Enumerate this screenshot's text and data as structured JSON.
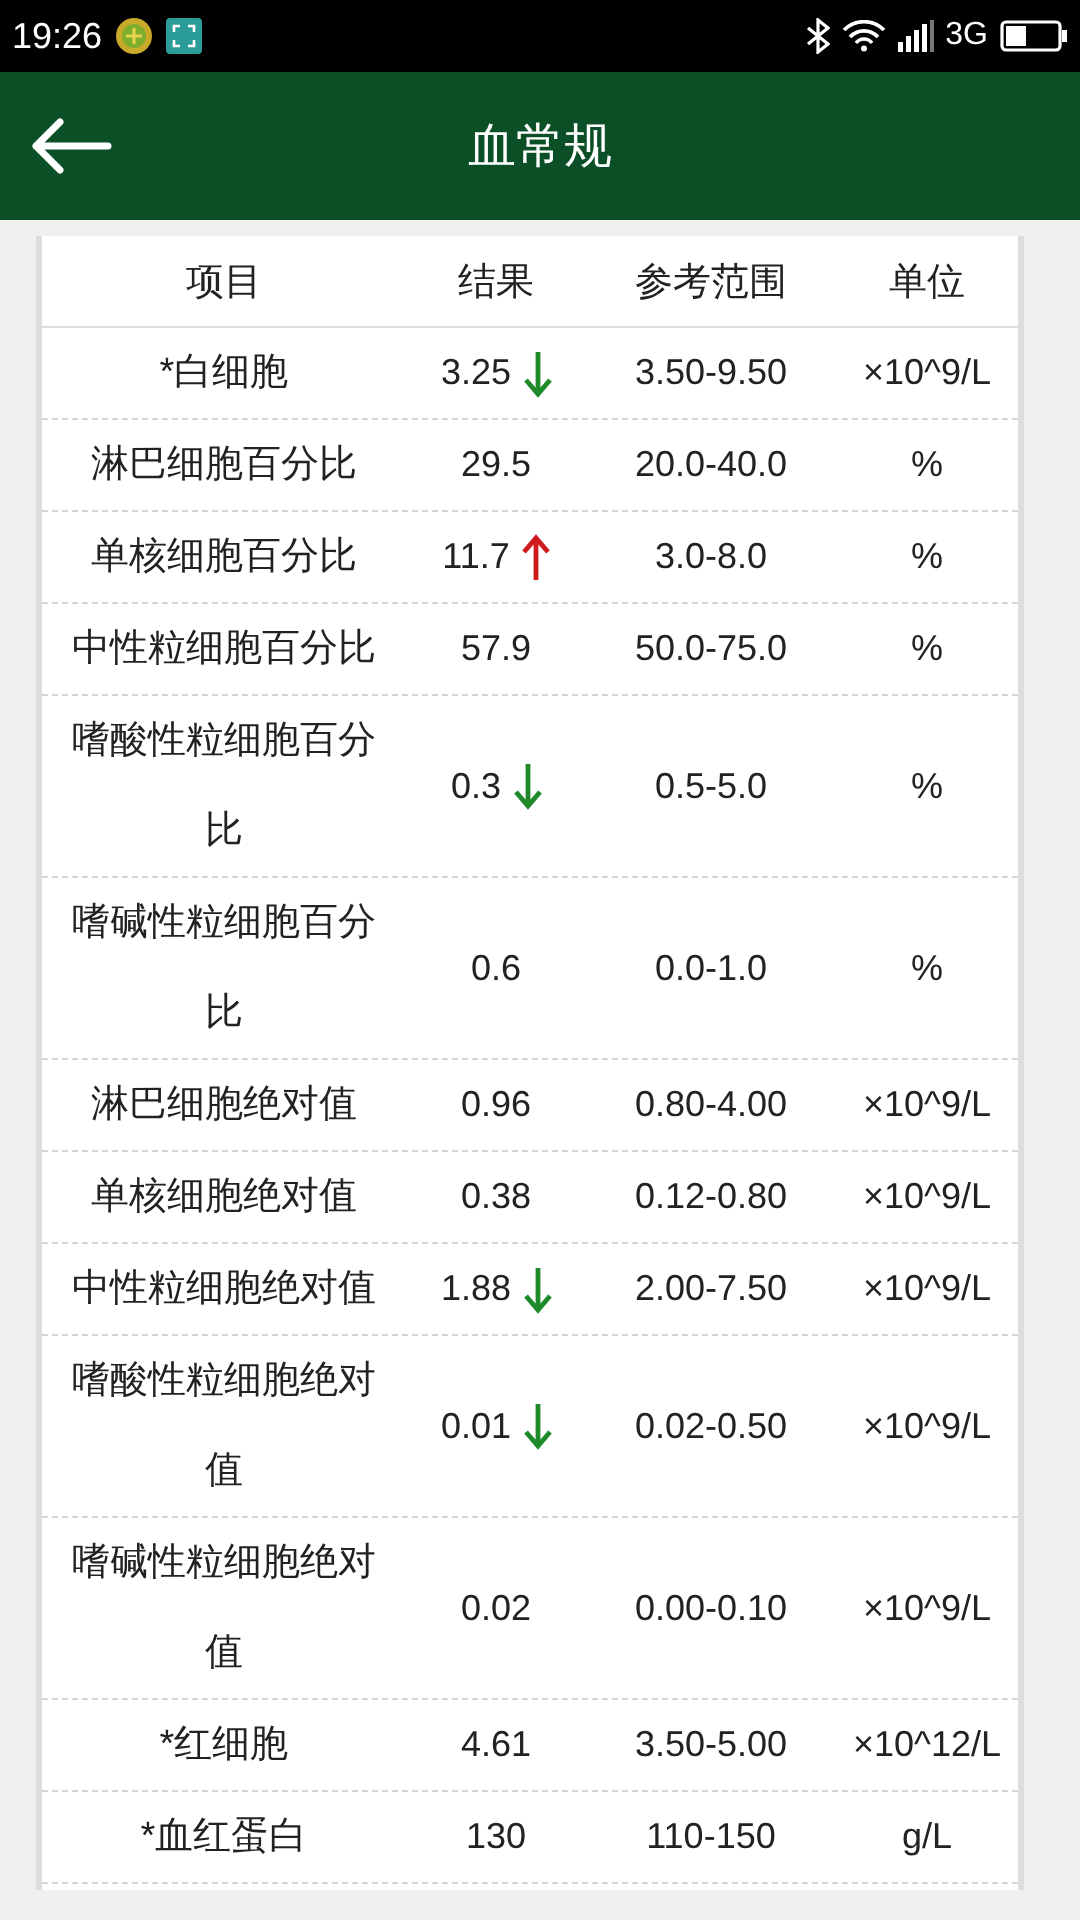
{
  "status_bar": {
    "time": "19:26",
    "network": "3G"
  },
  "header": {
    "title": "血常规"
  },
  "table": {
    "columns": [
      "项目",
      "结果",
      "参考范围",
      "单位"
    ],
    "rows": [
      {
        "item": "*白细胞",
        "result": "3.25",
        "low": true,
        "high": false,
        "range": "3.50-9.50",
        "unit": "×10^9/L"
      },
      {
        "item": "淋巴细胞百分比",
        "result": "29.5",
        "low": false,
        "high": false,
        "range": "20.0-40.0",
        "unit": "%"
      },
      {
        "item": "单核细胞百分比",
        "result": "11.7",
        "low": false,
        "high": true,
        "range": "3.0-8.0",
        "unit": "%"
      },
      {
        "item": "中性粒细胞百分比",
        "result": "57.9",
        "low": false,
        "high": false,
        "range": "50.0-75.0",
        "unit": "%"
      },
      {
        "item": "嗜酸性粒细胞百分比",
        "result": "0.3",
        "low": true,
        "high": false,
        "range": "0.5-5.0",
        "unit": "%"
      },
      {
        "item": "嗜碱性粒细胞百分比",
        "result": "0.6",
        "low": false,
        "high": false,
        "range": "0.0-1.0",
        "unit": "%"
      },
      {
        "item": "淋巴细胞绝对值",
        "result": "0.96",
        "low": false,
        "high": false,
        "range": "0.80-4.00",
        "unit": "×10^9/L"
      },
      {
        "item": "单核细胞绝对值",
        "result": "0.38",
        "low": false,
        "high": false,
        "range": "0.12-0.80",
        "unit": "×10^9/L"
      },
      {
        "item": "中性粒细胞绝对值",
        "result": "1.88",
        "low": true,
        "high": false,
        "range": "2.00-7.50",
        "unit": "×10^9/L"
      },
      {
        "item": "嗜酸性粒细胞绝对值",
        "result": "0.01",
        "low": true,
        "high": false,
        "range": "0.02-0.50",
        "unit": "×10^9/L"
      },
      {
        "item": "嗜碱性粒细胞绝对值",
        "result": "0.02",
        "low": false,
        "high": false,
        "range": "0.00-0.10",
        "unit": "×10^9/L"
      },
      {
        "item": "*红细胞",
        "result": "4.61",
        "low": false,
        "high": false,
        "range": "3.50-5.00",
        "unit": "×10^12/L"
      },
      {
        "item": "*血红蛋白",
        "result": "130",
        "low": false,
        "high": false,
        "range": "110-150",
        "unit": "g/L"
      }
    ]
  }
}
